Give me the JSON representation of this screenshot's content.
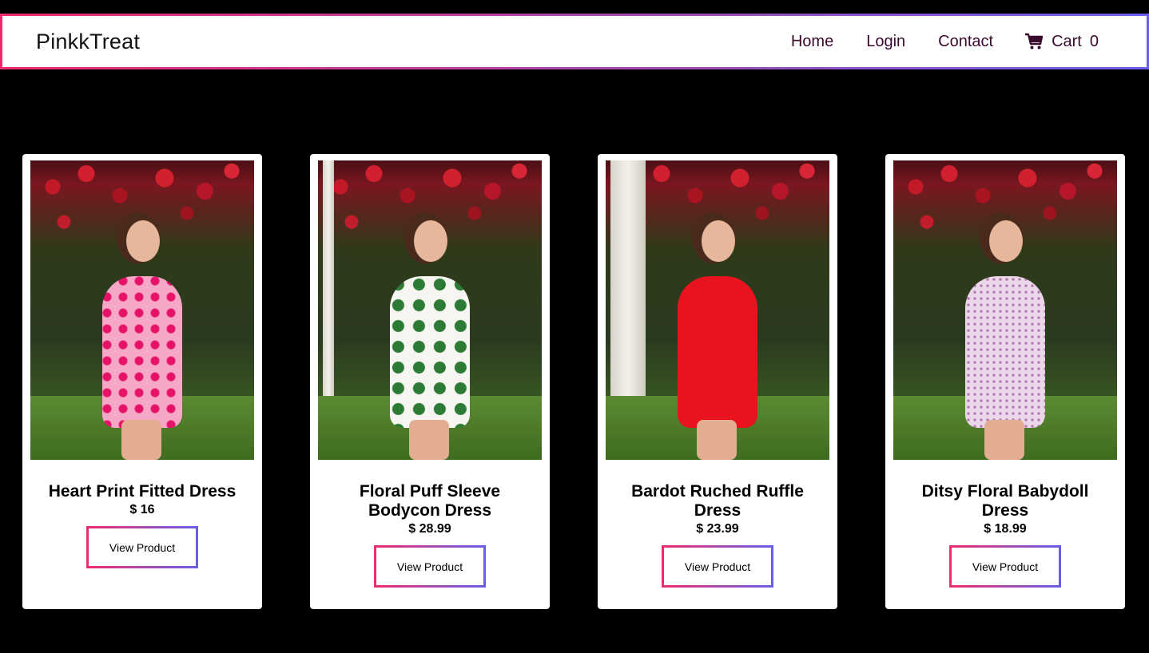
{
  "brand": "PinkkTreat",
  "nav": {
    "home": "Home",
    "login": "Login",
    "contact": "Contact",
    "cart_label": "Cart",
    "cart_count": "0"
  },
  "products": [
    {
      "title": "Heart Print Fitted Dress",
      "price": "$ 16",
      "button": "View Product"
    },
    {
      "title": "Floral Puff Sleeve Bodycon Dress",
      "price": "$ 28.99",
      "button": "View Product"
    },
    {
      "title": "Bardot Ruched Ruffle Dress",
      "price": "$ 23.99",
      "button": "View Product"
    },
    {
      "title": "Ditsy Floral Babydoll Dress",
      "price": "$ 18.99",
      "button": "View Product"
    }
  ],
  "colors": {
    "gradient_start": "#ee2c6e",
    "gradient_end": "#6a5fe8",
    "nav_text": "#3a0a2e",
    "background": "#000000"
  },
  "icons": {
    "cart": "shopping-cart-icon"
  }
}
